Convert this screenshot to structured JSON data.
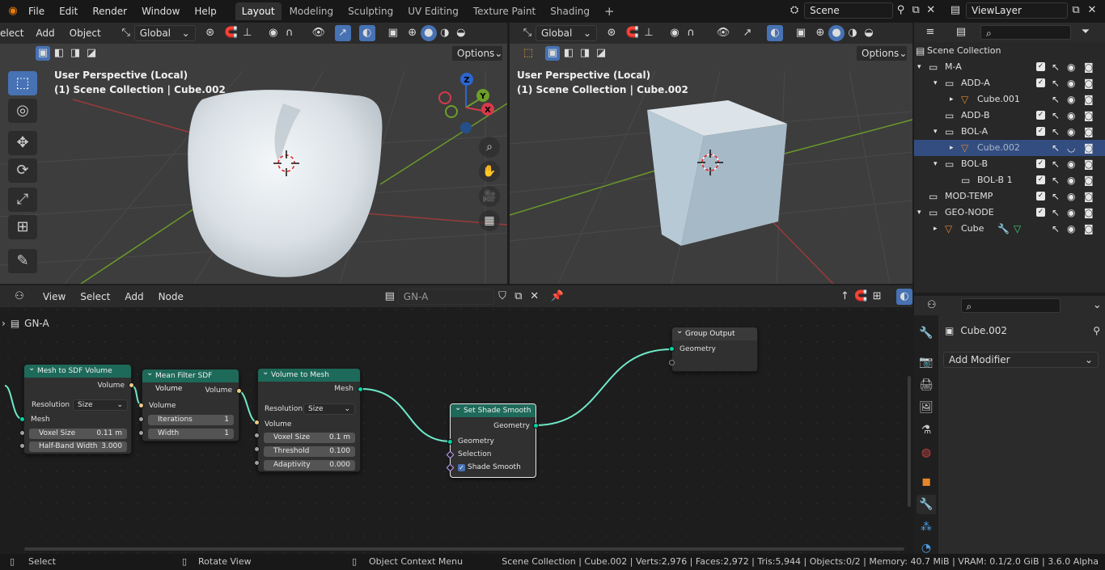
{
  "topbar": {
    "menus": [
      "File",
      "Edit",
      "Render",
      "Window",
      "Help"
    ],
    "workspaces": [
      "Layout",
      "Modeling",
      "Sculpting",
      "UV Editing",
      "Texture Paint",
      "Shading"
    ],
    "active_workspace": "Layout",
    "add_tab": "+",
    "scene_label": "Scene",
    "viewlayer_label": "ViewLayer"
  },
  "viewport_left": {
    "menus": [
      "elect",
      "Add",
      "Object"
    ],
    "orientation": "Global",
    "options_label": "Options",
    "perspective_text": "User Perspective (Local)",
    "collection_text": "(1) Scene Collection | Cube.002",
    "gizmo_axes": [
      "Z",
      "Y",
      "X"
    ]
  },
  "viewport_right": {
    "orientation": "Global",
    "options_label": "Options",
    "perspective_text": "User Perspective (Local)",
    "collection_text": "(1) Scene Collection | Cube.002"
  },
  "node_editor": {
    "menus": [
      "View",
      "Select",
      "Add",
      "Node"
    ],
    "node_group_name": "GN-A",
    "breadcrumb": "GN-A",
    "nodes": {
      "mesh_to_sdf": {
        "title": "Mesh to SDF Volume",
        "output": "Volume",
        "resolution_label": "Resolution",
        "resolution_value": "Size",
        "input_mesh": "Mesh",
        "voxel_size_label": "Voxel Size",
        "voxel_size_value": "0.11 m",
        "half_band_label": "Half-Band Width",
        "half_band_value": "3.000"
      },
      "mean_filter": {
        "title": "Mean Filter SDF Volume",
        "output": "Volume",
        "input_volume": "Volume",
        "iterations_label": "Iterations",
        "iterations_value": "1",
        "width_label": "Width",
        "width_value": "1"
      },
      "volume_to_mesh": {
        "title": "Volume to Mesh",
        "output": "Mesh",
        "resolution_label": "Resolution",
        "resolution_value": "Size",
        "input_volume": "Volume",
        "voxel_size_label": "Voxel Size",
        "voxel_size_value": "0.1 m",
        "threshold_label": "Threshold",
        "threshold_value": "0.100",
        "adaptivity_label": "Adaptivity",
        "adaptivity_value": "0.000"
      },
      "set_shade_smooth": {
        "title": "Set Shade Smooth",
        "output": "Geometry",
        "input_geometry": "Geometry",
        "input_selection": "Selection",
        "shade_smooth_label": "Shade Smooth",
        "shade_smooth_checked": true
      },
      "group_output": {
        "title": "Group Output",
        "input_geometry": "Geometry"
      }
    }
  },
  "outliner": {
    "root": "Scene Collection",
    "rows": [
      {
        "label": "M-A",
        "type": "collection"
      },
      {
        "label": "ADD-A",
        "type": "collection"
      },
      {
        "label": "Cube.001",
        "type": "mesh"
      },
      {
        "label": "ADD-B",
        "type": "collection"
      },
      {
        "label": "BOL-A",
        "type": "collection"
      },
      {
        "label": "Cube.002",
        "type": "mesh",
        "selected": true
      },
      {
        "label": "BOL-B",
        "type": "collection"
      },
      {
        "label": "BOL-B 1",
        "type": "collection"
      },
      {
        "label": "MOD-TEMP",
        "type": "collection"
      },
      {
        "label": "GEO-NODE",
        "type": "collection"
      },
      {
        "label": "Cube",
        "type": "mesh"
      }
    ]
  },
  "properties": {
    "object_name": "Cube.002",
    "add_modifier_label": "Add Modifier"
  },
  "statusbar": {
    "select": "Select",
    "rotate_view": "Rotate View",
    "context_menu": "Object Context Menu",
    "stats": "Scene Collection | Cube.002 | Verts:2,976 | Faces:2,972 | Tris:5,944 | Objects:0/2 | Memory: 40.7 MiB | VRAM: 0.1/2.0 GiB | 3.6.0 Alpha"
  },
  "colors": {
    "accent": "#4772b3",
    "node_header_geometry": "#1e6a5a",
    "geometry_socket": "#00d6a3",
    "selection_row": "#334d80"
  }
}
